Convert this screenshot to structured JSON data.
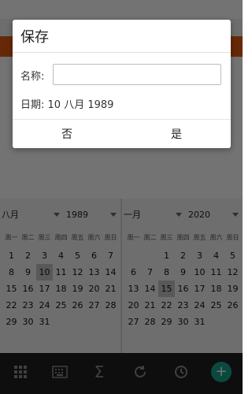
{
  "dialog": {
    "title": "保存",
    "name_label": "名称:",
    "name_value": "",
    "name_placeholder": "",
    "date_label": "日期:",
    "date_value": "10 八月 1989",
    "no_label": "否",
    "yes_label": "是"
  },
  "calendar_left": {
    "month": "八月",
    "year": "1989",
    "weekdays": [
      "周一",
      "周二",
      "周三",
      "周四",
      "周五",
      "周六",
      "周日"
    ],
    "rows": [
      [
        "",
        "1",
        "2",
        "3",
        "4",
        "5",
        "6"
      ],
      [
        "",
        "",
        "",
        "",
        "",
        "",
        ""
      ]
    ],
    "weeks": [
      [
        "1",
        "2",
        "3",
        "4",
        "5",
        "6",
        "7"
      ],
      [
        "8",
        "9",
        "10",
        "11",
        "12",
        "13",
        "14"
      ],
      [
        "15",
        "16",
        "17",
        "18",
        "19",
        "20",
        "21"
      ],
      [
        "22",
        "23",
        "24",
        "25",
        "26",
        "27",
        "28"
      ],
      [
        "29",
        "30",
        "31",
        "",
        "",
        "",
        ""
      ]
    ],
    "selected_day": "10"
  },
  "calendar_right": {
    "month": "一月",
    "year": "2020",
    "weekdays": [
      "周一",
      "周二",
      "周三",
      "周四",
      "周五",
      "周六",
      "周日"
    ],
    "weeks": [
      [
        "",
        "",
        "1",
        "2",
        "3",
        "4",
        "5"
      ],
      [
        "6",
        "7",
        "8",
        "9",
        "10",
        "11",
        "12"
      ],
      [
        "13",
        "14",
        "15",
        "16",
        "17",
        "18",
        "19"
      ],
      [
        "20",
        "21",
        "22",
        "23",
        "24",
        "25",
        "26"
      ],
      [
        "27",
        "28",
        "29",
        "30",
        "31",
        "",
        ""
      ]
    ],
    "selected_day": "15"
  },
  "toolbar": {
    "icons": [
      "grid-icon",
      "keyboard-icon",
      "sum-icon",
      "refresh-icon",
      "clock-icon",
      "add-icon"
    ],
    "accent": "#19a389"
  },
  "colors": {
    "orange": "#e35b12"
  }
}
